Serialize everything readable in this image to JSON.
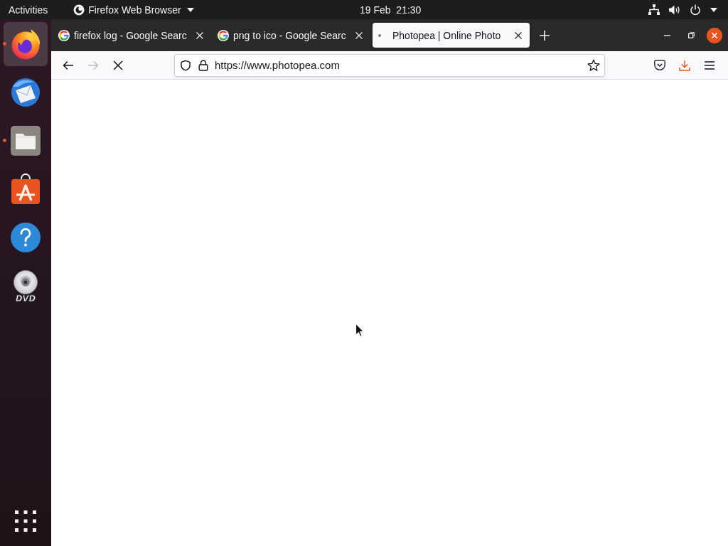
{
  "top_bar": {
    "activities": "Activities",
    "app_menu": "Firefox Web Browser",
    "clock": "19 Feb  21:30"
  },
  "dock": [
    {
      "kind": "browser",
      "running": true,
      "selected": true
    },
    {
      "kind": "mail",
      "running": false,
      "selected": false
    },
    {
      "kind": "files",
      "running": true,
      "selected": false
    },
    {
      "kind": "store",
      "running": false,
      "selected": false
    },
    {
      "kind": "help",
      "running": false,
      "selected": false
    },
    {
      "kind": "disc",
      "running": false,
      "selected": false,
      "label": "DVD"
    }
  ],
  "tabs": [
    {
      "title": "firefox log - Google Searc",
      "selected": false,
      "loading": false
    },
    {
      "title": "png to ico - Google Searc",
      "selected": false,
      "loading": false
    },
    {
      "title": "Photopea | Online Photo",
      "selected": true,
      "loading": true
    }
  ],
  "toolbar": {
    "navigation": [
      {
        "kind": "back",
        "disabled": false
      },
      {
        "kind": "forward",
        "disabled": true
      },
      {
        "kind": "stop",
        "disabled": false
      }
    ],
    "url": "https://www.photopea.com"
  }
}
